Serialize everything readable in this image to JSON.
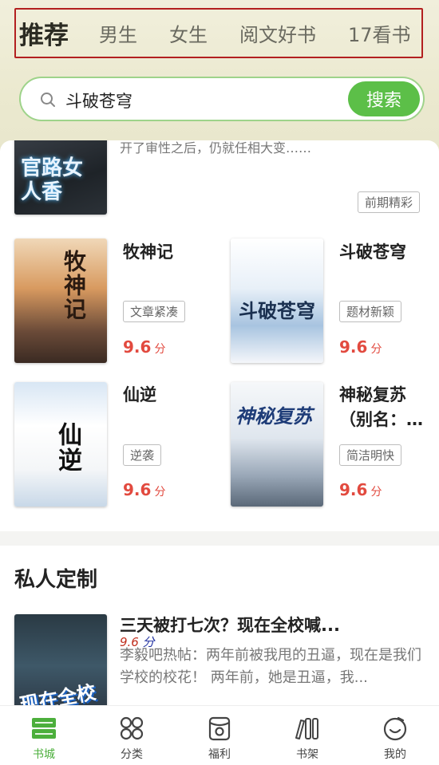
{
  "tabs": [
    {
      "label": "推荐",
      "active": true
    },
    {
      "label": "男生",
      "active": false
    },
    {
      "label": "女生",
      "active": false
    },
    {
      "label": "阅文好书",
      "active": false
    },
    {
      "label": "17看书",
      "active": false
    }
  ],
  "search": {
    "value": "斗破苍穹",
    "button": "搜索"
  },
  "featured": {
    "cover_text": "官路女人香",
    "desc_partial": "开了审性之后，仍就任相大变……",
    "badge": "前期精彩"
  },
  "books": [
    {
      "title": "牧神记",
      "tag": "文章紧凑",
      "score": "9.6",
      "unit": "分",
      "cover_text": "牧神记"
    },
    {
      "title": "斗破苍穹",
      "tag": "题材新颖",
      "score": "9.6",
      "unit": "分",
      "cover_text": "斗破苍穹"
    },
    {
      "title": "仙逆",
      "tag": "逆袭",
      "score": "9.6",
      "unit": "分",
      "cover_text": "仙逆"
    },
    {
      "title": "神秘复苏",
      "title_line2": "（别名：…",
      "tag": "简洁明快",
      "score": "9.6",
      "unit": "分",
      "cover_text": "神秘复苏"
    }
  ],
  "custom": {
    "section_title": "私人定制",
    "book_title": "三天被打七次？现在全校喊...",
    "score": "9.6",
    "unit": "分",
    "desc": "李毅吧热帖：两年前被我甩的丑逼，现在是我们学校的校花！ 两年前，她是丑逼，我...",
    "cover_text": "现在全校"
  },
  "nav": [
    {
      "label": "书城",
      "icon": "bookstore-icon",
      "active": true
    },
    {
      "label": "分类",
      "icon": "category-icon",
      "active": false
    },
    {
      "label": "福利",
      "icon": "welfare-icon",
      "active": false
    },
    {
      "label": "书架",
      "icon": "bookshelf-icon",
      "active": false
    },
    {
      "label": "我的",
      "icon": "profile-icon",
      "active": false
    }
  ],
  "colors": {
    "accent": "#5cbf48",
    "score": "#e24a3f",
    "active_tab_border": "#b32020"
  }
}
